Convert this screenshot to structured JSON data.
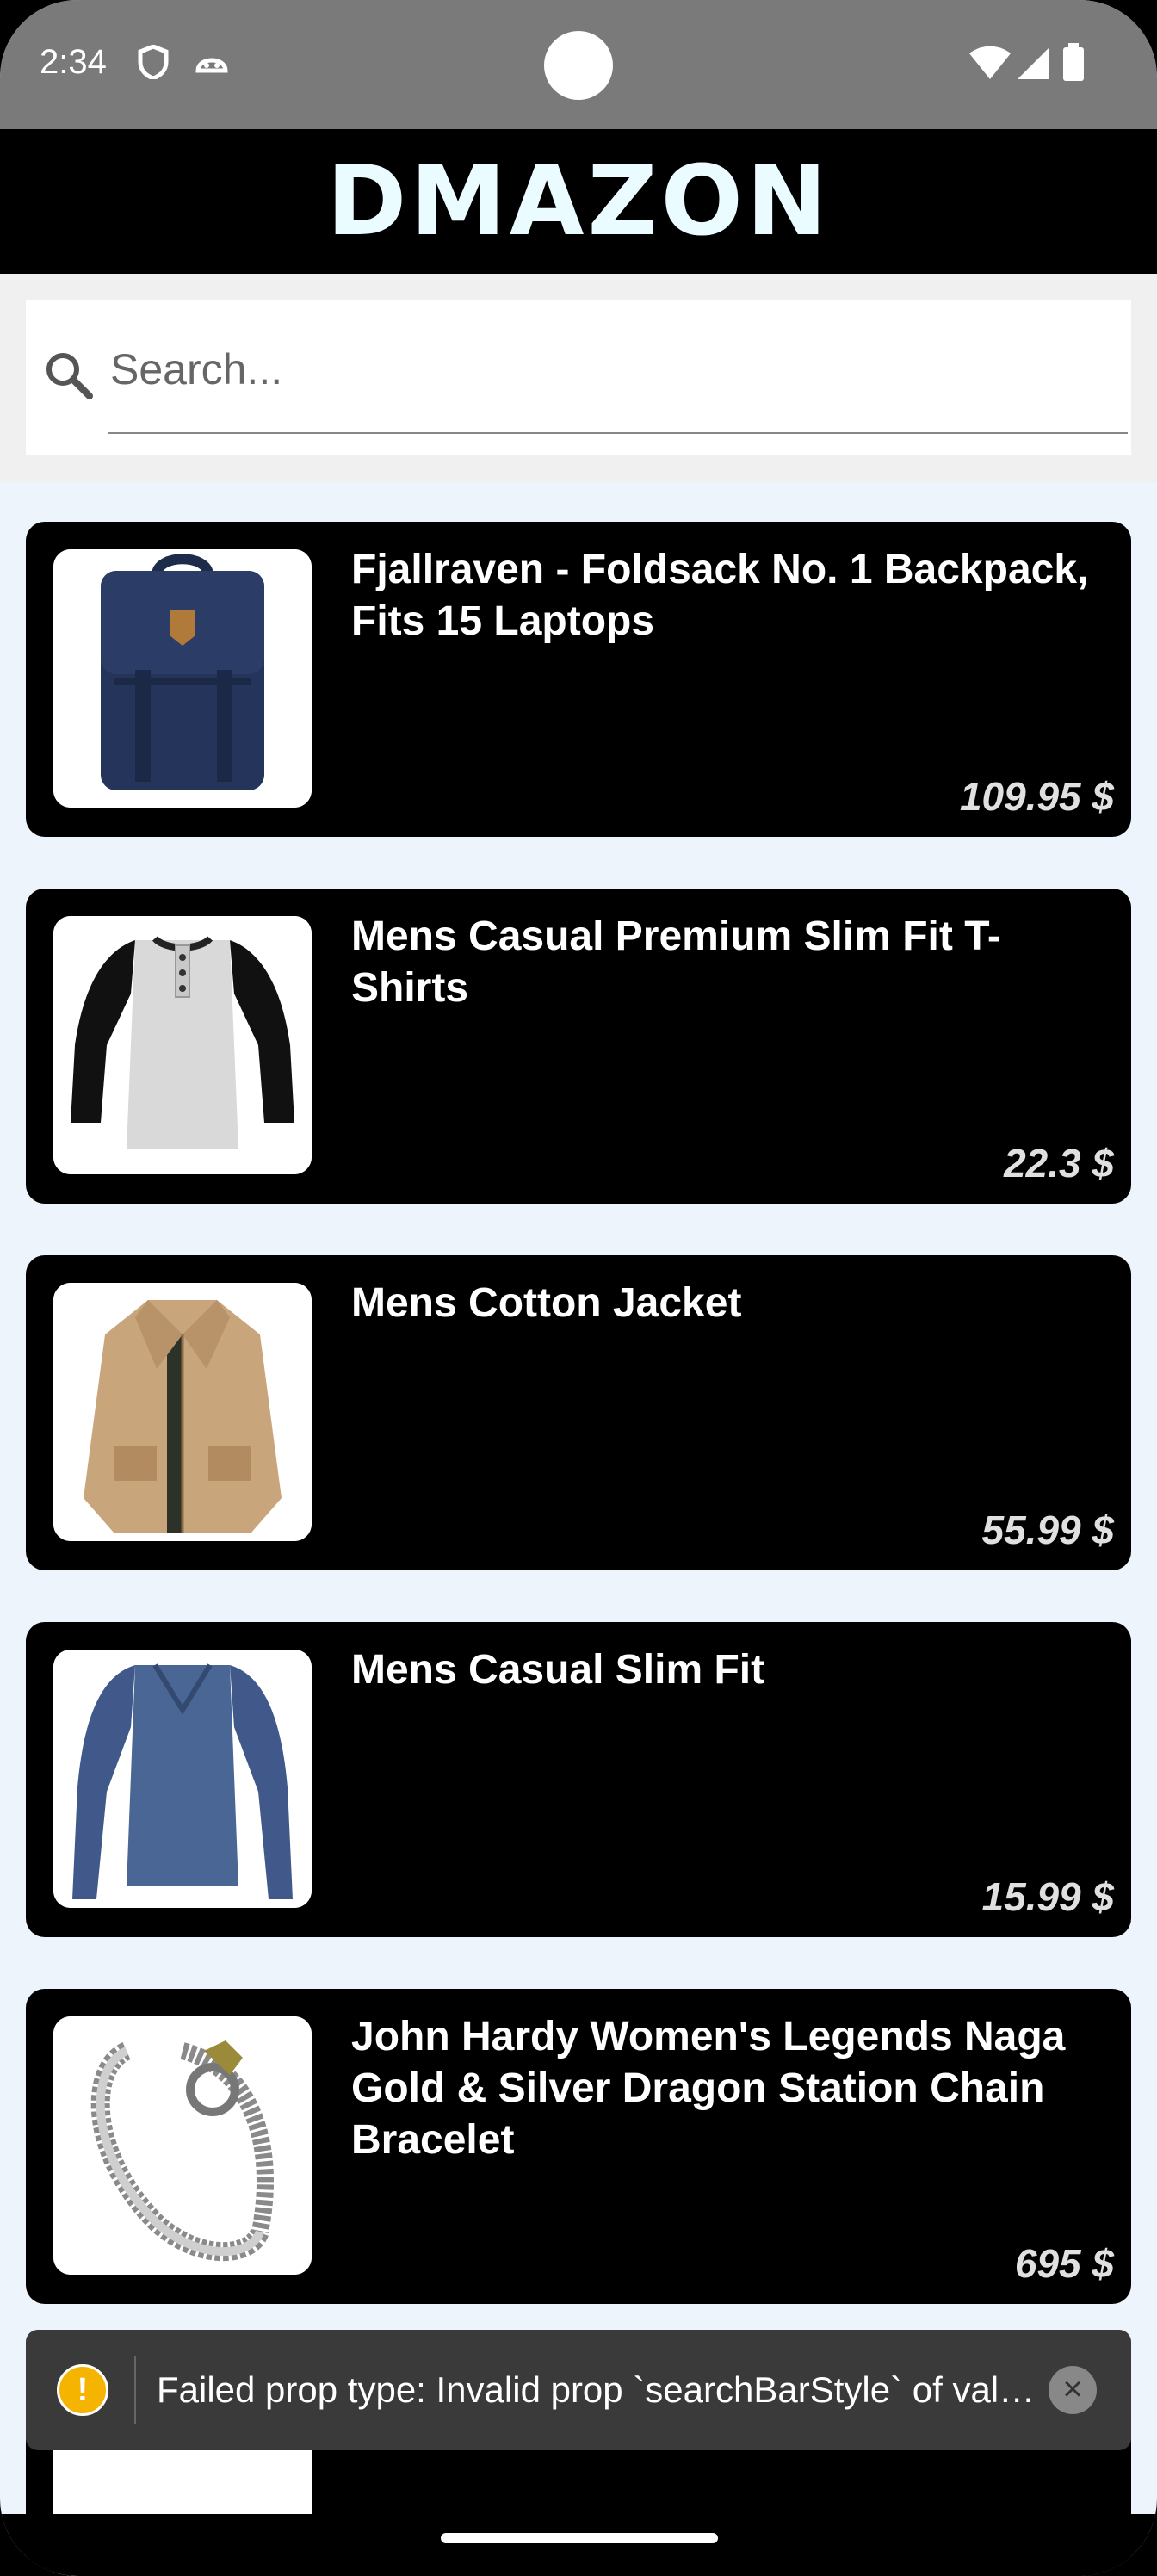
{
  "status_bar": {
    "time": "2:34",
    "left_icons": [
      "shield-icon",
      "android-icon"
    ],
    "right_icons": [
      "wifi-icon",
      "signal-icon",
      "battery-icon"
    ]
  },
  "header": {
    "title": "DMAZON"
  },
  "search": {
    "placeholder": "Search...",
    "value": ""
  },
  "products": [
    {
      "title": "Fjallraven - Foldsack No. 1 Backpack, Fits 15 Laptops",
      "price": "109.95 $",
      "image": "backpack"
    },
    {
      "title": "Mens Casual Premium Slim Fit T-Shirts",
      "price": "22.3 $",
      "image": "raglan-tshirt"
    },
    {
      "title": "Mens Cotton Jacket",
      "price": "55.99 $",
      "image": "jacket"
    },
    {
      "title": "Mens Casual Slim Fit",
      "price": "15.99 $",
      "image": "long-sleeve-shirt"
    },
    {
      "title": "John Hardy Women's Legends Naga Gold & Silver Dragon Station Chain Bracelet",
      "price": "695 $",
      "image": "bracelet"
    }
  ],
  "toast": {
    "message": "Failed prop type: Invalid prop `searchBarStyle` of value `minimal` supplied to `SearchBar`",
    "icon": "warning-icon"
  },
  "colors": {
    "header_bg": "#000000",
    "title_color": "#eafcff",
    "list_bg": "#edf4fc",
    "card_bg": "#000000",
    "toast_warning": "#f5b400"
  }
}
